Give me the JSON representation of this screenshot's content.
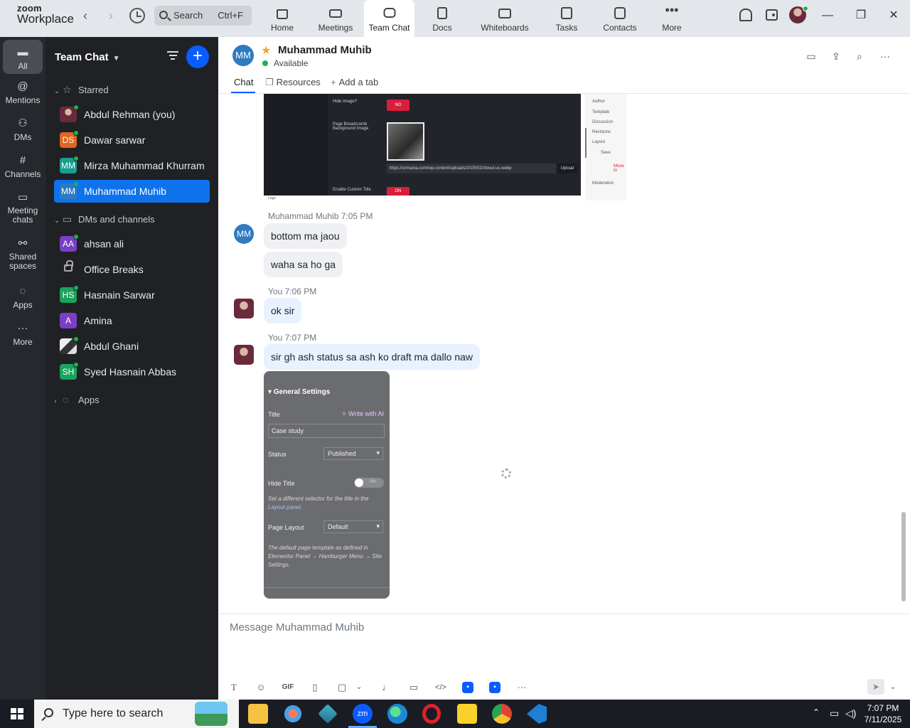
{
  "app": {
    "logo_line1": "zoom",
    "logo_line2": "Workplace",
    "search_placeholder": "Search",
    "search_shortcut": "Ctrl+F",
    "accent_color": "#0b5cff"
  },
  "top_tabs": [
    {
      "label": "Home",
      "icon": "home-icon"
    },
    {
      "label": "Meetings",
      "icon": "video-icon"
    },
    {
      "label": "Team Chat",
      "icon": "chat-icon",
      "active": true
    },
    {
      "label": "Docs",
      "icon": "doc-icon"
    },
    {
      "label": "Whiteboards",
      "icon": "whiteboard-icon"
    },
    {
      "label": "Tasks",
      "icon": "tasks-icon"
    },
    {
      "label": "Contacts",
      "icon": "contacts-icon"
    },
    {
      "label": "More",
      "icon": "more-icon"
    }
  ],
  "rail": [
    {
      "label": "All",
      "icon": "chat-bubble-icon",
      "active": true
    },
    {
      "label": "Mentions",
      "icon": "at-icon"
    },
    {
      "label": "DMs",
      "icon": "people-icon"
    },
    {
      "label": "Channels",
      "icon": "hash-icon"
    },
    {
      "label": "Meeting chats",
      "icon": "calendar-chat-icon"
    },
    {
      "label": "Shared spaces",
      "icon": "shared-icon"
    },
    {
      "label": "Apps",
      "icon": "apps-icon"
    },
    {
      "label": "More",
      "icon": "ellipsis-icon"
    }
  ],
  "sidebar": {
    "title": "Team Chat",
    "starred_label": "Starred",
    "starred": [
      {
        "initials": "",
        "name": "Abdul Rehman (you)",
        "color": "#6a2a3c",
        "photo": true,
        "online": true
      },
      {
        "initials": "DS",
        "name": "Dawar sarwar",
        "color": "#e0661f",
        "online": true
      },
      {
        "initials": "MM",
        "name": "Mirza Muhammad Khurram",
        "color": "#1a9e8f",
        "online": true
      },
      {
        "initials": "MM",
        "name": "Muhammad Muhib",
        "color": "#2e7bbf",
        "online": true,
        "active": true
      }
    ],
    "dms_label": "DMs and channels",
    "dms": [
      {
        "initials": "AA",
        "name": "ahsan ali",
        "color": "#7b3fc4",
        "online": true
      },
      {
        "initials": "",
        "name": "Office Breaks",
        "color": "",
        "lock": true
      },
      {
        "initials": "HS",
        "name": "Hasnain Sarwar",
        "color": "#1aa35c",
        "online": true
      },
      {
        "initials": "A",
        "name": "Amina",
        "color": "#7b3fc4",
        "online": false
      },
      {
        "initials": "",
        "name": "Abdul Ghani",
        "color": "#dddddd",
        "photo": true,
        "online": true
      },
      {
        "initials": "SH",
        "name": "Syed Hasnain Abbas",
        "color": "#1aa35c",
        "online": true
      }
    ],
    "apps_label": "Apps"
  },
  "chat": {
    "contact_initials": "MM",
    "contact_name": "Muhammad Muhib",
    "contact_status": "Available",
    "tabs": [
      "Chat",
      "Resources",
      "Add a tab"
    ],
    "composer_placeholder": "Message Muhammad Muhib",
    "messages": [
      {
        "sender": "Muhammad Muhib",
        "time": "7:05 PM",
        "texts": [
          "bottom ma jaou",
          "waha sa ho ga"
        ]
      },
      {
        "sender": "You",
        "time": "7:06 PM",
        "texts": [
          "ok sir"
        ]
      },
      {
        "sender": "You",
        "time": "7:07 PM",
        "texts": [
          "sir gh ash status sa ash ko draft ma dallo naw"
        ]
      }
    ],
    "screenshot1": {
      "hide_image_label": "Hide Image?",
      "no_label": "NO",
      "breadcrumb_label": "Page Breadcrumb Background Image",
      "url": "https://urmania.com/wp-content/uploads/2025/02/About-us.webp",
      "upload_label": "Upload",
      "enable_title_label": "Enable Custom Title",
      "on_label": "ON",
      "side_labels": [
        "Author",
        "Template",
        "Discussion",
        "Revisions",
        "Layout",
        "Save",
        "Move to",
        "Moderation"
      ],
      "image_caption": "Logo"
    },
    "screenshot2": {
      "heading": "General Settings",
      "title_label": "Title",
      "write_ai": "Write with AI",
      "title_value": "Case study",
      "status_label": "Status",
      "status_value": "Published",
      "hide_title_label": "Hide Title",
      "toggle_text": "No",
      "note1": "Set a different selector for the title in the",
      "note1_link": "Layout panel.",
      "page_layout_label": "Page Layout",
      "page_layout_value": "Default",
      "note2": "The default page template as defined in Elementor Panel → Hamburger Menu → Site Settings."
    }
  },
  "taskbar": {
    "search_placeholder": "Type here to search",
    "time": "7:07 PM",
    "date": "7/11/2025"
  }
}
